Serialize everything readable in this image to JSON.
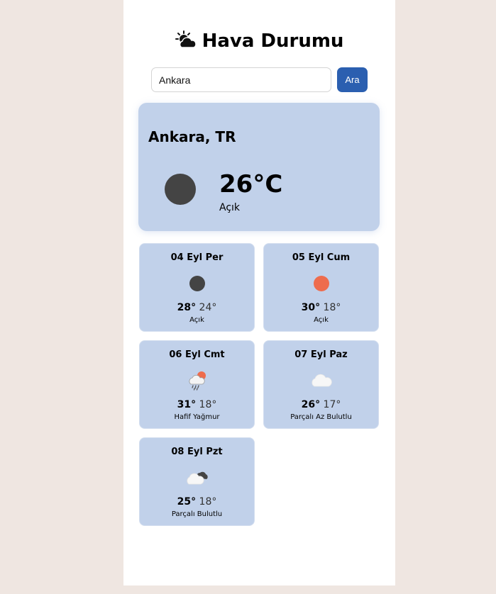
{
  "app": {
    "title": "Hava Durumu",
    "title_icon": "sun-behind-cloud-icon"
  },
  "search": {
    "value": "Ankara",
    "placeholder": "",
    "button_label": "Ara"
  },
  "current": {
    "city": "Ankara, TR",
    "temperature": "26°C",
    "description": "Açık",
    "icon": "clear-night-circle-icon",
    "icon_color": "#444444"
  },
  "forecast": [
    {
      "date": "04 Eyl Per",
      "max": "28°",
      "min": "24°",
      "description": "Açık",
      "icon": "clear-night-circle-icon",
      "icon_color": "#444444"
    },
    {
      "date": "05 Eyl Cum",
      "max": "30°",
      "min": "18°",
      "description": "Açık",
      "icon": "sun-circle-icon",
      "icon_color": "#ee6c4d"
    },
    {
      "date": "06 Eyl Cmt",
      "max": "31°",
      "min": "18°",
      "description": "Hafif Yağmur",
      "icon": "rain-cloud-sun-icon"
    },
    {
      "date": "07 Eyl Paz",
      "max": "26°",
      "min": "17°",
      "description": "Parçalı Az Bulutlu",
      "icon": "cloud-icon"
    },
    {
      "date": "08 Eyl Pzt",
      "max": "25°",
      "min": "18°",
      "description": "Parçalı Bulutlu",
      "icon": "cloud-dark-icon"
    }
  ],
  "colors": {
    "background": "#efe6e1",
    "card": "#c1d1ea",
    "button": "#2b5fb0"
  }
}
